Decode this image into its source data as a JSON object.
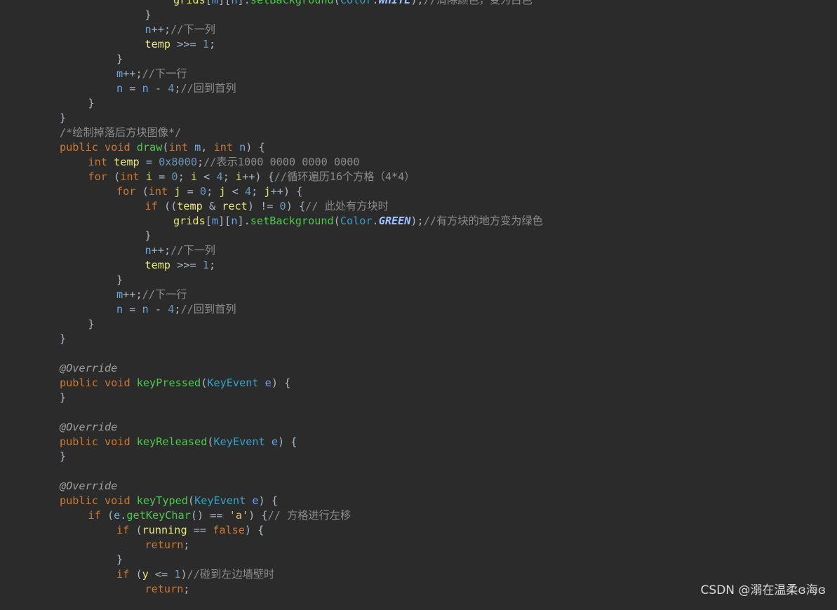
{
  "editor": {
    "theme": {
      "background": "#2b2b2b",
      "keyword": "#cc7832",
      "function": "#4ec94e",
      "variable": "#e8e87a",
      "parameter": "#6aa7e8",
      "class": "#3aa0c8",
      "number": "#6897bb",
      "string": "#e8bf6a",
      "comment": "#8c8c8c",
      "annotation": "#a0a0a0",
      "constant": "#9ec3ff",
      "plain": "#a9b7c6"
    },
    "lines": [
      {
        "indent": 6,
        "tokens": [
          [
            "v",
            "grids"
          ],
          [
            "p",
            "["
          ],
          [
            "pa",
            "m"
          ],
          [
            "p",
            "]["
          ],
          [
            "pa",
            "n"
          ],
          [
            "p",
            "]."
          ],
          [
            "f",
            "setBackground"
          ],
          [
            "p",
            "("
          ],
          [
            "c",
            "Color"
          ],
          [
            "p",
            "."
          ],
          [
            "k2",
            "WHITE"
          ],
          [
            "p",
            ");"
          ],
          [
            "cm",
            "//清除颜色，变为白色"
          ]
        ]
      },
      {
        "indent": 5,
        "tokens": [
          [
            "p",
            "}"
          ]
        ]
      },
      {
        "indent": 5,
        "tokens": [
          [
            "pa",
            "n"
          ],
          [
            "p",
            "++;"
          ],
          [
            "cm",
            "//下一列"
          ]
        ]
      },
      {
        "indent": 5,
        "tokens": [
          [
            "v",
            "temp"
          ],
          [
            "p",
            " >>= "
          ],
          [
            "n",
            "1"
          ],
          [
            "p",
            ";"
          ]
        ]
      },
      {
        "indent": 4,
        "tokens": [
          [
            "p",
            "}"
          ]
        ]
      },
      {
        "indent": 4,
        "tokens": [
          [
            "pa",
            "m"
          ],
          [
            "p",
            "++;"
          ],
          [
            "cm",
            "//下一行"
          ]
        ]
      },
      {
        "indent": 4,
        "tokens": [
          [
            "pa",
            "n"
          ],
          [
            "p",
            " = "
          ],
          [
            "pa",
            "n"
          ],
          [
            "p",
            " - "
          ],
          [
            "n",
            "4"
          ],
          [
            "p",
            ";"
          ],
          [
            "cm",
            "//回到首列"
          ]
        ]
      },
      {
        "indent": 3,
        "tokens": [
          [
            "p",
            "}"
          ]
        ]
      },
      {
        "indent": 2,
        "tokens": [
          [
            "p",
            "}"
          ]
        ]
      },
      {
        "indent": 2,
        "tokens": [
          [
            "cm",
            "/*绘制掉落后方块图像*/"
          ]
        ]
      },
      {
        "indent": 2,
        "tokens": [
          [
            "k",
            "public"
          ],
          [
            "p",
            " "
          ],
          [
            "k",
            "void"
          ],
          [
            "p",
            " "
          ],
          [
            "f",
            "draw"
          ],
          [
            "p",
            "("
          ],
          [
            "k",
            "int"
          ],
          [
            "p",
            " "
          ],
          [
            "pa",
            "m"
          ],
          [
            "p",
            ", "
          ],
          [
            "k",
            "int"
          ],
          [
            "p",
            " "
          ],
          [
            "pa",
            "n"
          ],
          [
            "p",
            ") {"
          ]
        ]
      },
      {
        "indent": 3,
        "tokens": [
          [
            "k",
            "int"
          ],
          [
            "p",
            " "
          ],
          [
            "v",
            "temp"
          ],
          [
            "p",
            " = "
          ],
          [
            "n",
            "0x8000"
          ],
          [
            "p",
            ";"
          ],
          [
            "cm",
            "//表示1000 0000 0000 0000"
          ]
        ]
      },
      {
        "indent": 3,
        "tokens": [
          [
            "k",
            "for"
          ],
          [
            "p",
            " ("
          ],
          [
            "k",
            "int"
          ],
          [
            "p",
            " "
          ],
          [
            "v",
            "i"
          ],
          [
            "p",
            " = "
          ],
          [
            "n",
            "0"
          ],
          [
            "p",
            "; "
          ],
          [
            "v",
            "i"
          ],
          [
            "p",
            " < "
          ],
          [
            "n",
            "4"
          ],
          [
            "p",
            "; "
          ],
          [
            "v",
            "i"
          ],
          [
            "p",
            "++) {"
          ],
          [
            "cm",
            "//循环遍历16个方格（4*4）"
          ]
        ]
      },
      {
        "indent": 4,
        "tokens": [
          [
            "k",
            "for"
          ],
          [
            "p",
            " ("
          ],
          [
            "k",
            "int"
          ],
          [
            "p",
            " "
          ],
          [
            "v",
            "j"
          ],
          [
            "p",
            " = "
          ],
          [
            "n",
            "0"
          ],
          [
            "p",
            "; "
          ],
          [
            "v",
            "j"
          ],
          [
            "p",
            " < "
          ],
          [
            "n",
            "4"
          ],
          [
            "p",
            "; "
          ],
          [
            "v",
            "j"
          ],
          [
            "p",
            "++) {"
          ]
        ]
      },
      {
        "indent": 5,
        "tokens": [
          [
            "k",
            "if"
          ],
          [
            "p",
            " (("
          ],
          [
            "v",
            "temp"
          ],
          [
            "p",
            " & "
          ],
          [
            "v",
            "rect"
          ],
          [
            "p",
            ") != "
          ],
          [
            "n",
            "0"
          ],
          [
            "p",
            ") {"
          ],
          [
            "cm",
            "// 此处有方块时"
          ]
        ]
      },
      {
        "indent": 6,
        "tokens": [
          [
            "v",
            "grids"
          ],
          [
            "p",
            "["
          ],
          [
            "pa",
            "m"
          ],
          [
            "p",
            "]["
          ],
          [
            "pa",
            "n"
          ],
          [
            "p",
            "]."
          ],
          [
            "f",
            "setBackground"
          ],
          [
            "p",
            "("
          ],
          [
            "c",
            "Color"
          ],
          [
            "p",
            "."
          ],
          [
            "k2",
            "GREEN"
          ],
          [
            "p",
            ");"
          ],
          [
            "cm",
            "//有方块的地方变为绿色"
          ]
        ]
      },
      {
        "indent": 5,
        "tokens": [
          [
            "p",
            "}"
          ]
        ]
      },
      {
        "indent": 5,
        "tokens": [
          [
            "pa",
            "n"
          ],
          [
            "p",
            "++;"
          ],
          [
            "cm",
            "//下一列"
          ]
        ]
      },
      {
        "indent": 5,
        "tokens": [
          [
            "v",
            "temp"
          ],
          [
            "p",
            " >>= "
          ],
          [
            "n",
            "1"
          ],
          [
            "p",
            ";"
          ]
        ]
      },
      {
        "indent": 4,
        "tokens": [
          [
            "p",
            "}"
          ]
        ]
      },
      {
        "indent": 4,
        "tokens": [
          [
            "pa",
            "m"
          ],
          [
            "p",
            "++;"
          ],
          [
            "cm",
            "//下一行"
          ]
        ]
      },
      {
        "indent": 4,
        "tokens": [
          [
            "pa",
            "n"
          ],
          [
            "p",
            " = "
          ],
          [
            "pa",
            "n"
          ],
          [
            "p",
            " - "
          ],
          [
            "n",
            "4"
          ],
          [
            "p",
            ";"
          ],
          [
            "cm",
            "//回到首列"
          ]
        ]
      },
      {
        "indent": 3,
        "tokens": [
          [
            "p",
            "}"
          ]
        ]
      },
      {
        "indent": 2,
        "tokens": [
          [
            "p",
            "}"
          ]
        ]
      },
      {
        "indent": 2,
        "tokens": []
      },
      {
        "indent": 2,
        "tokens": [
          [
            "an",
            "@Override"
          ]
        ]
      },
      {
        "indent": 2,
        "tokens": [
          [
            "k",
            "public"
          ],
          [
            "p",
            " "
          ],
          [
            "k",
            "void"
          ],
          [
            "p",
            " "
          ],
          [
            "f",
            "keyPressed"
          ],
          [
            "p",
            "("
          ],
          [
            "c",
            "KeyEvent"
          ],
          [
            "p",
            " "
          ],
          [
            "pa",
            "e"
          ],
          [
            "p",
            ") {"
          ]
        ]
      },
      {
        "indent": 2,
        "tokens": [
          [
            "p",
            "}"
          ]
        ]
      },
      {
        "indent": 2,
        "tokens": []
      },
      {
        "indent": 2,
        "tokens": [
          [
            "an",
            "@Override"
          ]
        ]
      },
      {
        "indent": 2,
        "tokens": [
          [
            "k",
            "public"
          ],
          [
            "p",
            " "
          ],
          [
            "k",
            "void"
          ],
          [
            "p",
            " "
          ],
          [
            "f",
            "keyReleased"
          ],
          [
            "p",
            "("
          ],
          [
            "c",
            "KeyEvent"
          ],
          [
            "p",
            " "
          ],
          [
            "pa",
            "e"
          ],
          [
            "p",
            ") {"
          ]
        ]
      },
      {
        "indent": 2,
        "tokens": [
          [
            "p",
            "}"
          ]
        ]
      },
      {
        "indent": 2,
        "tokens": []
      },
      {
        "indent": 2,
        "tokens": [
          [
            "an",
            "@Override"
          ]
        ]
      },
      {
        "indent": 2,
        "tokens": [
          [
            "k",
            "public"
          ],
          [
            "p",
            " "
          ],
          [
            "k",
            "void"
          ],
          [
            "p",
            " "
          ],
          [
            "f",
            "keyTyped"
          ],
          [
            "p",
            "("
          ],
          [
            "c",
            "KeyEvent"
          ],
          [
            "p",
            " "
          ],
          [
            "pa",
            "e"
          ],
          [
            "p",
            ") {"
          ]
        ]
      },
      {
        "indent": 3,
        "tokens": [
          [
            "k",
            "if"
          ],
          [
            "p",
            " ("
          ],
          [
            "pa",
            "e"
          ],
          [
            "p",
            "."
          ],
          [
            "f",
            "getKeyChar"
          ],
          [
            "p",
            "() == "
          ],
          [
            "s",
            "'a'"
          ],
          [
            "p",
            ") {"
          ],
          [
            "cm",
            "// 方格进行左移"
          ]
        ]
      },
      {
        "indent": 4,
        "tokens": [
          [
            "k",
            "if"
          ],
          [
            "p",
            " ("
          ],
          [
            "v",
            "running"
          ],
          [
            "p",
            " == "
          ],
          [
            "k",
            "false"
          ],
          [
            "p",
            ") {"
          ]
        ]
      },
      {
        "indent": 5,
        "tokens": [
          [
            "k",
            "return"
          ],
          [
            "p",
            ";"
          ]
        ]
      },
      {
        "indent": 4,
        "tokens": [
          [
            "p",
            "}"
          ]
        ]
      },
      {
        "indent": 4,
        "tokens": [
          [
            "k",
            "if"
          ],
          [
            "p",
            " ("
          ],
          [
            "v",
            "y"
          ],
          [
            "p",
            " <= "
          ],
          [
            "n",
            "1"
          ],
          [
            "p",
            ")"
          ],
          [
            "cm",
            "//碰到左边墙壁时"
          ]
        ]
      },
      {
        "indent": 5,
        "tokens": [
          [
            "k",
            "return"
          ],
          [
            "p",
            ";"
          ]
        ]
      }
    ]
  },
  "watermark": {
    "text": "CSDN @溺在温柔ɞ海ɞ"
  }
}
